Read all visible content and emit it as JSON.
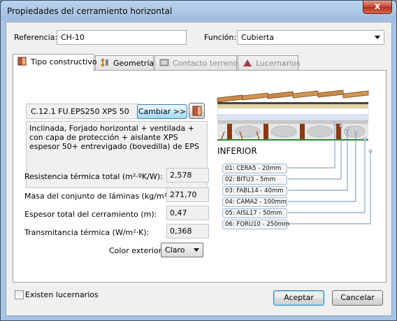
{
  "window": {
    "title": "Propiedades del cerramiento horizontal",
    "close_glyph": "x"
  },
  "form": {
    "referencia_label": "Referencia:",
    "referencia_value": "CH-10",
    "funcion_label": "Función:",
    "funcion_value": "Cubierta"
  },
  "tabs": [
    {
      "label": "Tipo constructivo",
      "icon": "wall-layers-icon",
      "active": true,
      "enabled": true
    },
    {
      "label": "Geometría",
      "icon": "height-arrows-icon",
      "active": false,
      "enabled": true
    },
    {
      "label": "Contacto terreno",
      "icon": "ground-contact-icon",
      "active": false,
      "enabled": false
    },
    {
      "label": "Lucernarios",
      "icon": "skylight-icon",
      "active": false,
      "enabled": false
    }
  ],
  "construction": {
    "code": "C.12.1 FU.EPS250 XPS 50",
    "change_button": "Cambiar >>",
    "description": "Inclinada, Forjado horizontal + ventilada + con capa de protección + aislante XPS espesor 50+ entrevigado (bovedilla) de EPS"
  },
  "properties": [
    {
      "label": "Resistencia térmica total  (m²·ºK/W):",
      "value": "2,578"
    },
    {
      "label": "Masa del conjunto de láminas (kg/m²):",
      "value": "271,70"
    },
    {
      "label": "Espesor total del cerramiento (m):",
      "value": "0,47"
    },
    {
      "label": "Transmitancia térmica (W/m²·K):",
      "value": "0,368"
    }
  ],
  "color_exterior": {
    "label": "Color exterior:",
    "value": "Claro"
  },
  "diagram": {
    "side_label": "INFERIOR",
    "layers": [
      "01: CERA5 - 20mm",
      "02: BITU3 - 5mm",
      "03: FABL14 - 40mm",
      "04: CAMA2 - 100mm",
      "05: AISL17 - 50mm",
      "06: FORU10 - 250mm"
    ],
    "colors": {
      "tile": "#c98a4a",
      "concrete": "#c8c8c8",
      "beam": "#8b3a12",
      "insulation": "#d9e7f5",
      "green": "#2e8b2e"
    }
  },
  "footer": {
    "skylights_checkbox": "Existen lucernarios",
    "accept": "Aceptar",
    "cancel": "Cancelar"
  }
}
